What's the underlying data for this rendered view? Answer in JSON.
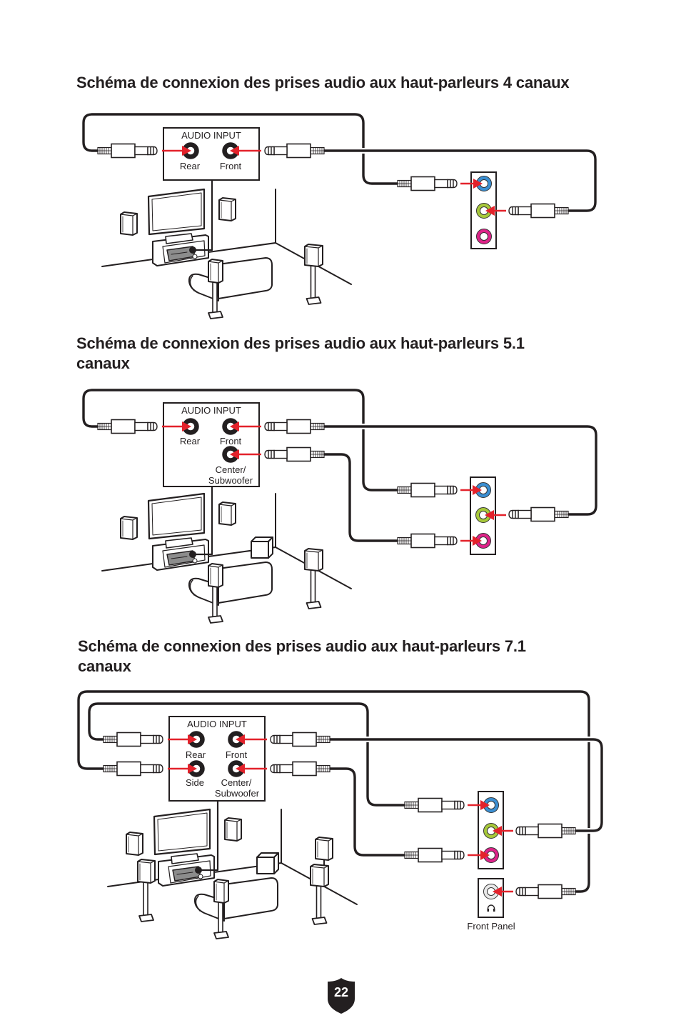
{
  "page": {
    "number": "22"
  },
  "colors": {
    "ink": "#231f20",
    "arrow": "#e3222b",
    "jack_blue": "#3b8fd2",
    "jack_green": "#a7c83a",
    "jack_pink": "#de2389",
    "jack_headphone": "#e8e8e8",
    "receiver": "#8c8c8c",
    "badge": "#231f20"
  },
  "sections": [
    {
      "heading": "Schéma de connexion des prises audio aux haut-parleurs 4 canaux",
      "channels": "4",
      "audio_input": {
        "title": "AUDIO INPUT",
        "rear": "Rear",
        "front": "Front"
      },
      "io_panel": {
        "jacks": [
          "blue",
          "green",
          "pink"
        ]
      },
      "room_speakers": [
        "front-left",
        "front-right",
        "rear-left",
        "rear-right"
      ]
    },
    {
      "heading": "Schéma de connexion des prises audio aux haut-parleurs 5.1 canaux",
      "channels": "5.1",
      "audio_input": {
        "title": "AUDIO INPUT",
        "rear": "Rear",
        "front": "Front",
        "center_line1": "Center/",
        "center_line2": "Subwoofer"
      },
      "io_panel": {
        "jacks": [
          "blue",
          "green",
          "pink"
        ]
      },
      "room_speakers": [
        "front-left",
        "front-right",
        "center",
        "subwoofer",
        "rear-left",
        "rear-right"
      ]
    },
    {
      "heading": "Schéma de connexion des prises audio aux haut-parleurs 7.1 canaux",
      "channels": "7.1",
      "audio_input": {
        "title": "AUDIO INPUT",
        "rear": "Rear",
        "front": "Front",
        "side": "Side",
        "center_line1": "Center/",
        "center_line2": "Subwoofer"
      },
      "io_panel": {
        "jacks": [
          "blue",
          "green",
          "pink"
        ]
      },
      "front_panel": {
        "label": "Front Panel",
        "jack": "headphone"
      },
      "room_speakers": [
        "front-left",
        "front-right",
        "center",
        "subwoofer",
        "side-left",
        "side-right",
        "rear-left",
        "rear-right"
      ]
    }
  ]
}
